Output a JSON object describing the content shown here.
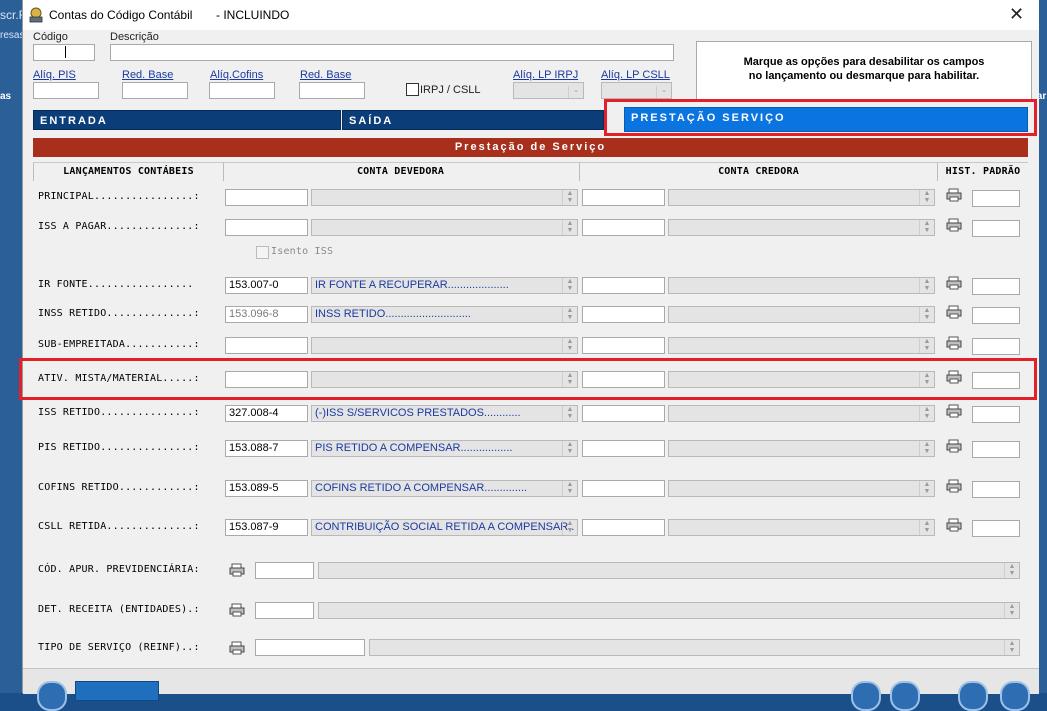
{
  "window": {
    "title": "Contas do Código Contábil",
    "mode": "INCLUINDO"
  },
  "behind": {
    "left_text_1": "scr.F",
    "left_text_2": "resas",
    "left_text_3": "as",
    "right_text_1": "lar"
  },
  "form": {
    "codigo_label": "Código",
    "descricao_label": "Descrição",
    "aliq_pis_label": "Alíq. PIS",
    "red_base_label_1": "Red. Base",
    "aliq_cofins_label": "Alíq.Cofins",
    "red_base_label_2": "Red. Base",
    "irpj_csll_label": "IRPJ / CSLL",
    "aliq_lp_irpj_label": "Alíq. LP IRPJ",
    "aliq_lp_csll_label": "Alíq. LP CSLL",
    "info_line_1": "Marque as opções para desabilitar os campos",
    "info_line_2": "no lançamento ou desmarque para habilitar."
  },
  "tabs": {
    "entrada": "ENTRADA",
    "saida": "SAÍDA",
    "prestacao": "PRESTAÇÃO SERVIÇO"
  },
  "section": {
    "title": "Prestação de Serviço",
    "col_lancamentos": "LANÇAMENTOS CONTÁBEIS",
    "col_devedora": "CONTA DEVEDORA",
    "col_credora": "CONTA CREDORA",
    "col_hist": "HIST. PADRÃO"
  },
  "rows": {
    "principal": {
      "label": "PRINCIPAL................:",
      "code": "",
      "desc": ""
    },
    "iss_pagar": {
      "label": "ISS A PAGAR..............:",
      "code": "",
      "desc": ""
    },
    "isento_iss": "Isento ISS",
    "ir_fonte": {
      "label": "IR FONTE.................",
      "code": "153.007-0",
      "desc": "IR FONTE A RECUPERAR...................."
    },
    "inss_retido": {
      "label": "INSS RETIDO..............:",
      "code": "153.096-8",
      "desc": "INSS RETIDO............................"
    },
    "sub_empreitada": {
      "label": "SUB-EMPREITADA...........:",
      "code": "",
      "desc": ""
    },
    "ativ_mista": {
      "label": "ATIV. MISTA/MATERIAL.....:",
      "code": "",
      "desc": ""
    },
    "iss_retido": {
      "label": "ISS RETIDO...............:",
      "code": "327.008-4",
      "desc": "(-)ISS S/SERVICOS PRESTADOS............"
    },
    "pis_retido": {
      "label": "PIS RETIDO...............:",
      "code": "153.088-7",
      "desc": "PIS RETIDO A COMPENSAR................."
    },
    "cofins_retido": {
      "label": "COFINS RETIDO............:",
      "code": "153.089-5",
      "desc": "COFINS RETIDO A COMPENSAR.............."
    },
    "csll_retida": {
      "label": "CSLL RETIDA..............:",
      "code": "153.087-9",
      "desc": "CONTRIBUIÇÃO SOCIAL RETIDA A COMPENSAR.."
    },
    "cod_apur": "CÓD. APUR. PREVIDENCIÁRIA:",
    "det_receita": "DET. RECEITA (ENTIDADES).:",
    "tipo_servico": "TIPO DE SERVIÇO (REINF)..:"
  },
  "colors": {
    "tab_dark": "#0b3d78",
    "tab_active": "#0a74e0",
    "section_bar": "#a92f1d",
    "highlight": "#e32028"
  }
}
